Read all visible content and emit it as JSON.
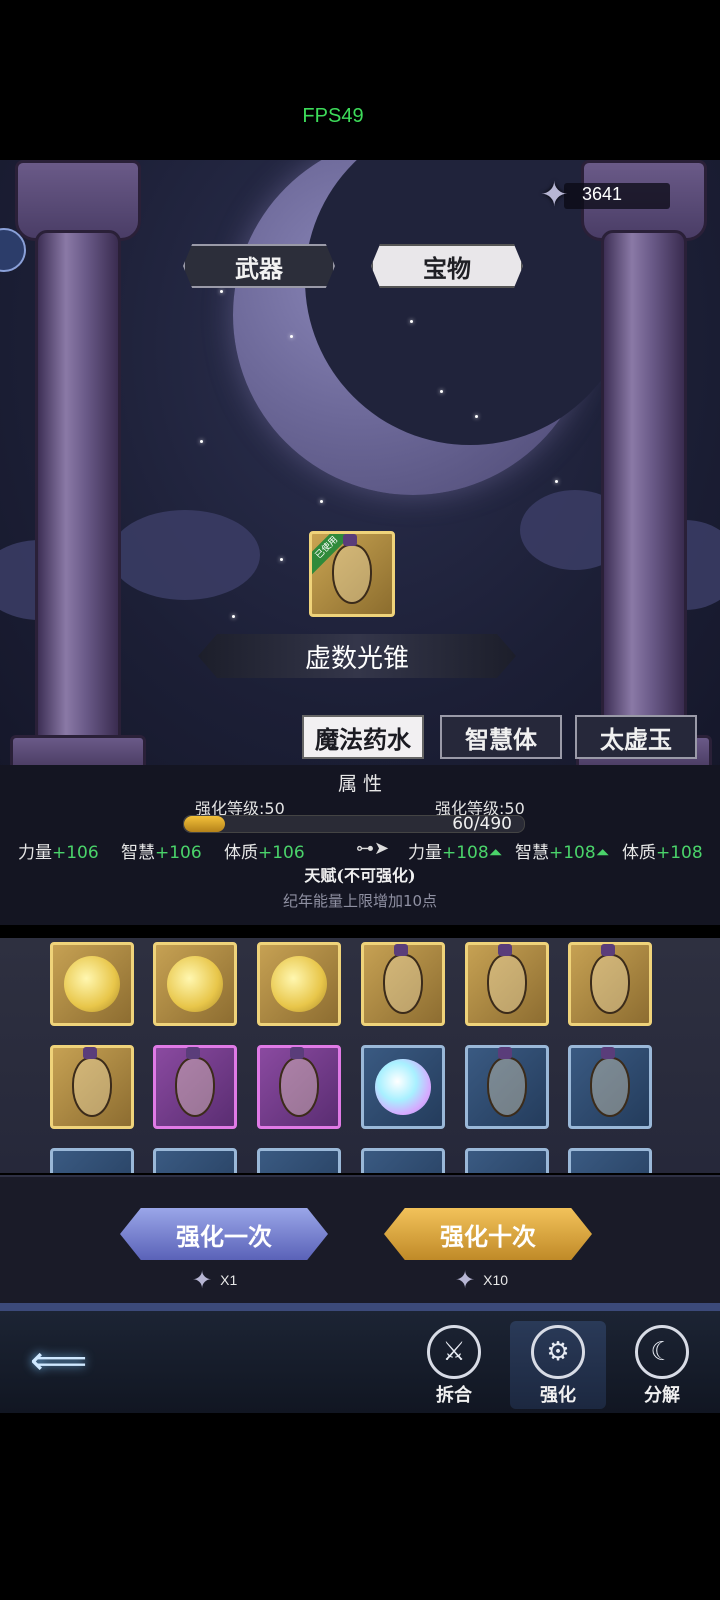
{
  "overlay": {
    "fps": "FPS49"
  },
  "header": {
    "currency": {
      "icon": "star-icon",
      "value": "3641"
    },
    "tabs": [
      {
        "label": "武器",
        "active": false
      },
      {
        "label": "宝物",
        "active": true
      }
    ]
  },
  "featured_item": {
    "badge": "已使用",
    "name": "虚数光锥"
  },
  "subtabs": [
    {
      "label": "魔法药水",
      "active": true
    },
    {
      "label": "智慧体",
      "active": false
    },
    {
      "label": "太虚玉",
      "active": false
    }
  ],
  "stats": {
    "title": "属 性",
    "current_level": "强化等级:50",
    "next_level": "强化等级:50",
    "progress_text": "60/490",
    "progress_fraction": 0.122,
    "current_attrs": [
      {
        "name": "力量",
        "value": "+106"
      },
      {
        "name": "智慧",
        "value": "+106"
      },
      {
        "name": "体质",
        "value": "+106"
      }
    ],
    "next_attrs": [
      {
        "name": "力量",
        "value": "+108"
      },
      {
        "name": "智慧",
        "value": "+108"
      },
      {
        "name": "体质",
        "value": "+108"
      }
    ],
    "talent_title": "天赋(不可强化)",
    "talent_desc": "纪年能量上限增加10点"
  },
  "actions": {
    "enhance_once": "强化一次",
    "enhance_once_cost": "X1",
    "enhance_ten": "强化十次",
    "enhance_ten_cost": "X10"
  },
  "nav": {
    "back_icon": "back-arrow-icon",
    "items": [
      {
        "label": "拆合",
        "icon": "disassemble-icon",
        "active": false
      },
      {
        "label": "强化",
        "icon": "enhance-gear-icon",
        "active": true
      },
      {
        "label": "分解",
        "icon": "decompose-icon",
        "active": false
      }
    ]
  }
}
